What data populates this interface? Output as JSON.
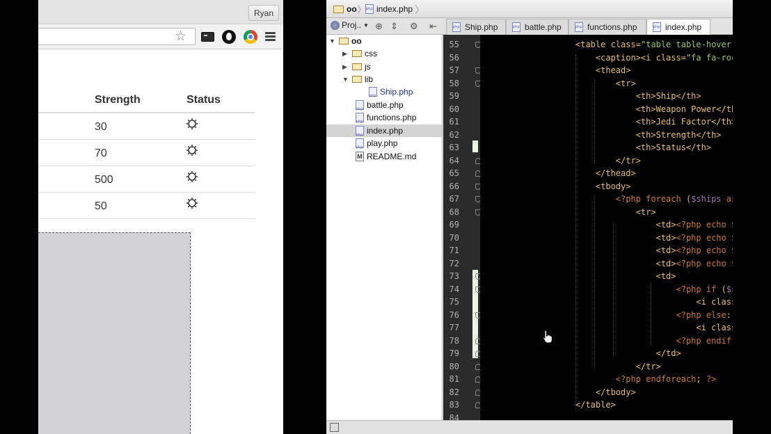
{
  "browser": {
    "user_name": "Ryan",
    "table": {
      "headers": [
        "Strength",
        "Status"
      ],
      "rows": [
        {
          "strength": "30"
        },
        {
          "strength": "70"
        },
        {
          "strength": "500"
        },
        {
          "strength": "50"
        }
      ]
    }
  },
  "ide": {
    "breadcrumb": [
      "oo",
      "index.php"
    ],
    "project_label": "Proj..",
    "tabs": [
      {
        "label": "Ship.php",
        "active": false
      },
      {
        "label": "battle.php",
        "active": false
      },
      {
        "label": "functions.php",
        "active": false
      },
      {
        "label": "index.php",
        "active": true
      }
    ],
    "tree": [
      {
        "label": "oo",
        "type": "folder",
        "expanded": true,
        "depth": 0
      },
      {
        "label": "css",
        "type": "folder",
        "expanded": false,
        "depth": 1
      },
      {
        "label": "js",
        "type": "folder",
        "expanded": false,
        "depth": 1
      },
      {
        "label": "lib",
        "type": "folder",
        "expanded": true,
        "depth": 1
      },
      {
        "label": "Ship.php",
        "type": "php",
        "depth": 2
      },
      {
        "label": "battle.php",
        "type": "php",
        "depth": 1
      },
      {
        "label": "functions.php",
        "type": "php",
        "depth": 1
      },
      {
        "label": "index.php",
        "type": "php",
        "depth": 1,
        "selected": true
      },
      {
        "label": "play.php",
        "type": "php",
        "depth": 1
      },
      {
        "label": "README.md",
        "type": "md",
        "depth": 1
      }
    ],
    "line_numbers": [
      "55",
      "56",
      "57",
      "58",
      "59",
      "60",
      "61",
      "62",
      "63",
      "64",
      "65",
      "66",
      "67",
      "68",
      "69",
      "70",
      "71",
      "72",
      "73",
      "74",
      "75",
      "76",
      "77",
      "78",
      "79",
      "80",
      "81",
      "82",
      "83",
      "84"
    ],
    "code_lines": [
      "<table class=\"table table-hover\">",
      "    <caption><i class=\"fa fa-rocket\"></i>",
      "    <thead>",
      "        <tr>",
      "            <th>Ship</th>",
      "            <th>Weapon Power</th>",
      "            <th>Jedi Factor</th>",
      "            <th>Strength</th>",
      "            <th>Status</th>",
      "        </tr>",
      "    </thead>",
      "    <tbody>",
      "        <?php foreach ($ships as $ship):",
      "            <tr>",
      "                <td><?php echo $ship->get",
      "                <td><?php echo $ship->get",
      "                <td><?php echo $ship->get",
      "                <td><?php echo $ship->get",
      "                <td>",
      "                    <?php if ($ship->isFu",
      "                        <i class=\"fa fa-s",
      "                    <?php else: ?>",
      "                        <i class=\"fa fa-c",
      "                    <?php endif; ?>",
      "                </td>",
      "            </tr>",
      "        <?php endforeach; ?>",
      "    </tbody>",
      "</table>",
      ""
    ]
  },
  "colors": {
    "editor_bg": "#000000",
    "tag": "#e8bf6a",
    "keyword": "#cc7832",
    "variable": "#9876aa",
    "string": "#a5c25c",
    "line_number": "#b3b3b3"
  }
}
